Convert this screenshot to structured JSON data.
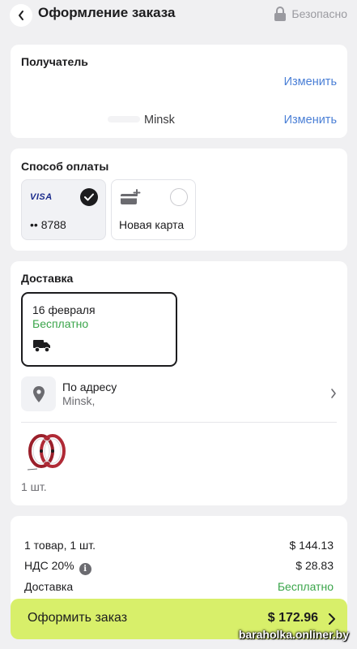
{
  "header": {
    "title": "Оформление заказа",
    "secure_label": "Безопасно"
  },
  "recipient": {
    "title": "Получатель",
    "change_label_1": "Изменить",
    "change_label_2": "Изменить",
    "city": "Minsk"
  },
  "payment": {
    "title": "Способ оплаты",
    "cards": [
      {
        "brand": "VISA",
        "number": "•• 8788",
        "selected": true
      },
      {
        "label": "Новая карта",
        "selected": false
      }
    ]
  },
  "delivery": {
    "title": "Доставка",
    "date": "16 февраля",
    "price": "Бесплатно",
    "method_title": "По адресу",
    "method_city": "Minsk,",
    "quantity": "1 шт."
  },
  "totals": {
    "rows": [
      {
        "label": "1 товар, 1 шт.",
        "value": "$ 144.13"
      },
      {
        "label": "НДС 20%",
        "value": "$ 28.83"
      },
      {
        "label": "Доставка",
        "value": "Бесплатно"
      }
    ]
  },
  "order": {
    "label": "Оформить заказ",
    "total": "$ 172.96"
  },
  "watermark": "baraholka.onliner.by",
  "colors": {
    "accent_link": "#4a7fd6",
    "success": "#3aa54a",
    "order_button": "#d8ef6a",
    "background": "#f0f0f2"
  }
}
